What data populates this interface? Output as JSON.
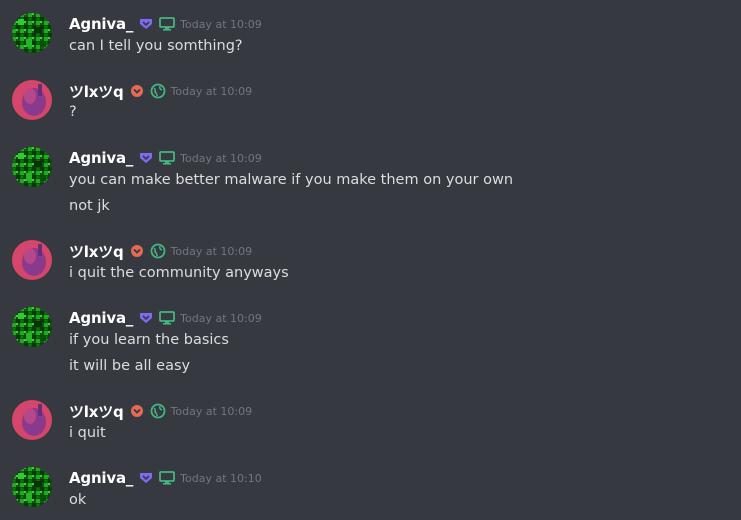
{
  "colors": {
    "background": "#36393f",
    "username": "#ffffff",
    "text": "#dcddde",
    "timestamp": "#72767d",
    "badge_purple": "#7b6cf3",
    "badge_red": "#e56b53",
    "desktop_green": "#43b581",
    "globe_green": "#43b581"
  },
  "icons": {
    "agniva_badge": "purple-shield-badge-icon",
    "agniva_platform": "desktop-monitor-icon",
    "tylxtyq_badge": "red-chevron-badge-icon",
    "tylxtyq_platform": "globe-icon"
  },
  "messages": [
    {
      "author": "Agniva_",
      "timestamp": "Today at 10:09",
      "lines": [
        "can I tell you somthing?"
      ]
    },
    {
      "author": "ツlxツq",
      "timestamp": "Today at 10:09",
      "lines": [
        "?"
      ]
    },
    {
      "author": "Agniva_",
      "timestamp": "Today at 10:09",
      "lines": [
        "you can make better malware if you make them on your own",
        "not jk"
      ]
    },
    {
      "author": "ツlxツq",
      "timestamp": "Today at 10:09",
      "lines": [
        "i quit the community anyways"
      ]
    },
    {
      "author": "Agniva_",
      "timestamp": "Today at 10:09",
      "lines": [
        "if you learn the basics",
        "it will be all easy"
      ]
    },
    {
      "author": "ツlxツq",
      "timestamp": "Today at 10:09",
      "lines": [
        "i quit"
      ]
    },
    {
      "author": "Agniva_",
      "timestamp": "Today at 10:10",
      "lines": [
        "ok"
      ]
    }
  ]
}
